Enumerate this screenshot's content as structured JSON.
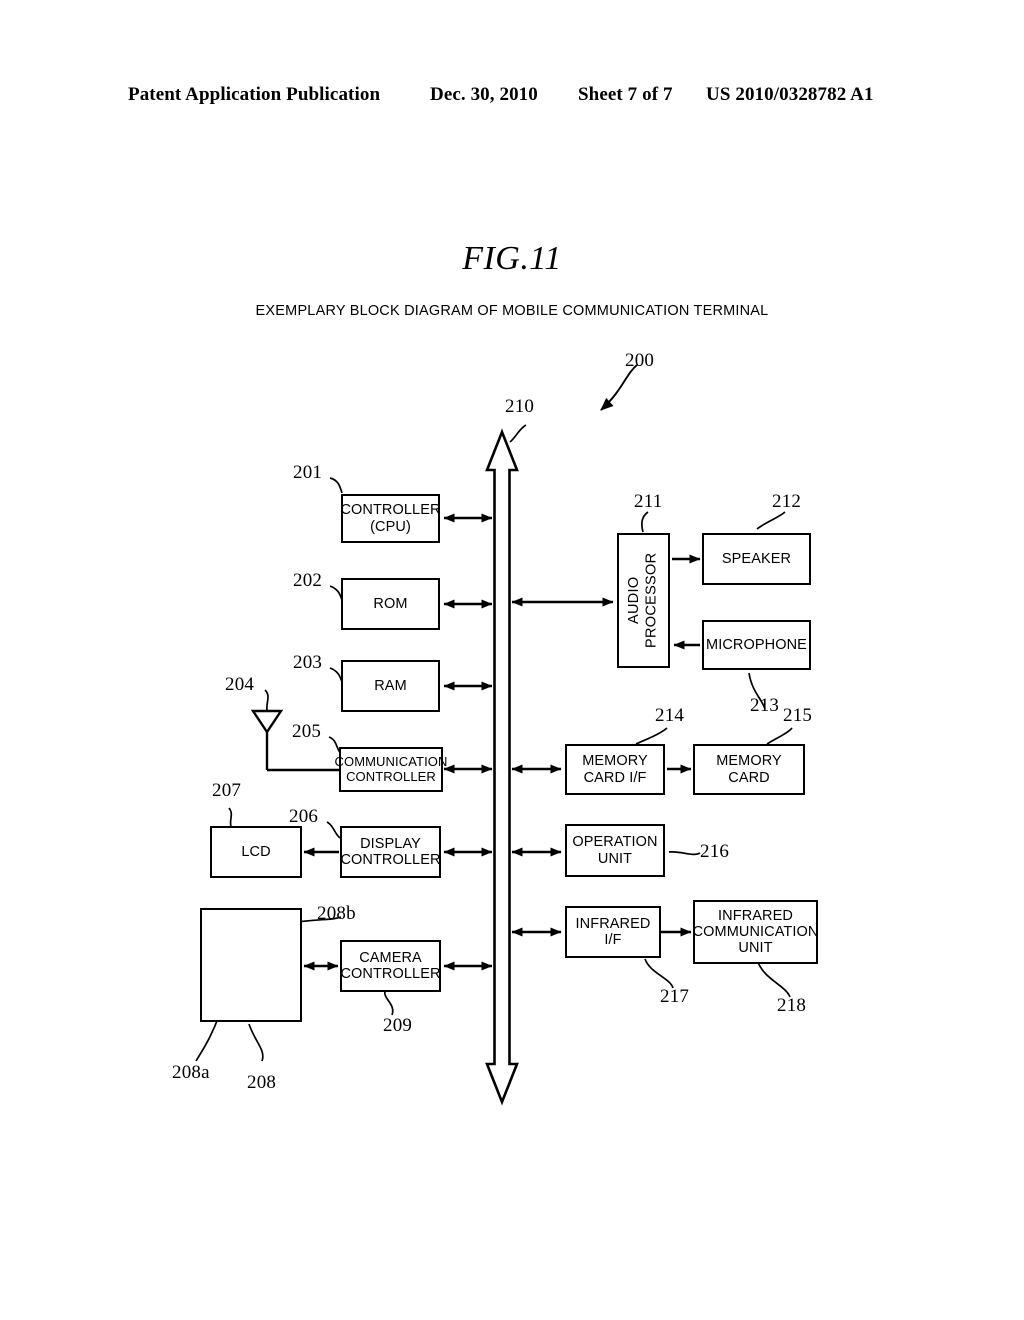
{
  "header": {
    "publication": "Patent Application Publication",
    "date": "Dec. 30, 2010",
    "sheet": "Sheet 7 of 7",
    "patent_number": "US 2010/0328782 A1"
  },
  "figure": {
    "label": "FIG.11",
    "caption": "EXEMPLARY BLOCK DIAGRAM OF MOBILE COMMUNICATION TERMINAL"
  },
  "blocks": {
    "controller": "CONTROLLER\n(CPU)",
    "rom": "ROM",
    "ram": "RAM",
    "communication_controller": "COMMUNICATION\nCONTROLLER",
    "display_controller": "DISPLAY\nCONTROLLER",
    "lcd": "LCD",
    "camera_controller": "CAMERA\nCONTROLLER",
    "audio_processor": "AUDIO\nPROCESSOR",
    "speaker": "SPEAKER",
    "microphone": "MICROPHONE",
    "memory_card_if": "MEMORY\nCARD I/F",
    "memory_card": "MEMORY\nCARD",
    "operation_unit": "OPERATION\nUNIT",
    "infrared_if": "INFRARED\nI/F",
    "infrared_communication_unit": "INFRARED\nCOMMUNICATION\nUNIT"
  },
  "refs": {
    "terminal": "200",
    "controller": "201",
    "rom": "202",
    "ram": "203",
    "antenna": "204",
    "communication_controller": "205",
    "display_controller": "206",
    "lcd": "207",
    "camera_module": "208",
    "camera_lens": "208a",
    "camera_sensor": "208b",
    "camera_controller": "209",
    "bus": "210",
    "audio_processor": "211",
    "speaker": "212",
    "microphone": "213",
    "memory_card_if": "214",
    "memory_card": "215",
    "operation_unit": "216",
    "infrared_if": "217",
    "infrared_communication_unit": "218"
  }
}
